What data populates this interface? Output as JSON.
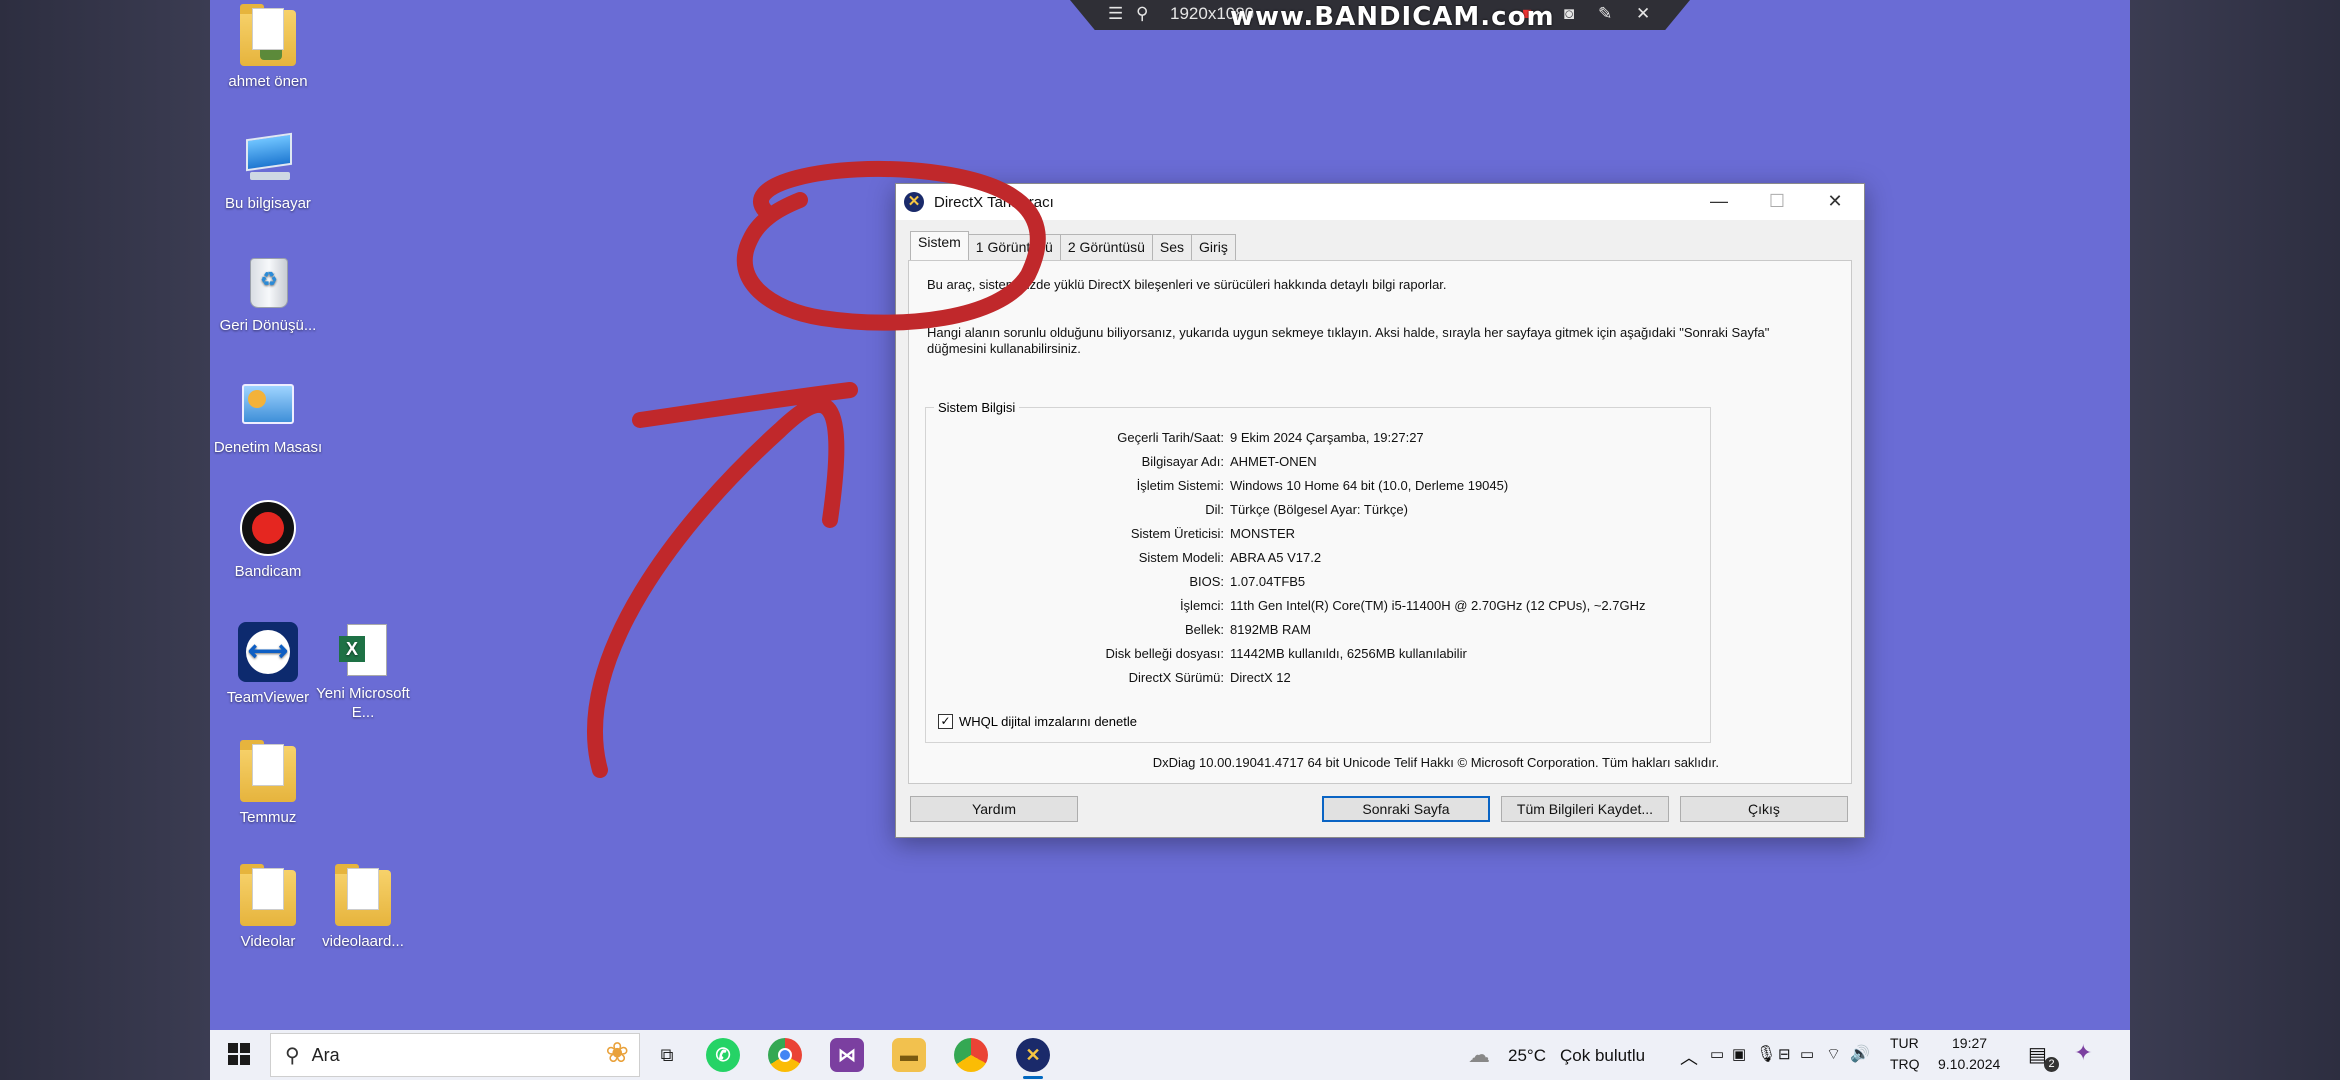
{
  "bandicam": {
    "resolution": "1920x1080",
    "watermark": "www.BANDICAM.com"
  },
  "desktop_icons": [
    {
      "label": "ahmet önen",
      "icon": "user-folder-icon"
    },
    {
      "label": "Bu bilgisayar",
      "icon": "computer-icon"
    },
    {
      "label": "Geri Dönüşü...",
      "icon": "recycle-bin-icon"
    },
    {
      "label": "Denetim Masası",
      "icon": "control-panel-icon"
    },
    {
      "label": "Bandicam",
      "icon": "bandicam-icon"
    },
    {
      "label": "TeamViewer",
      "icon": "teamviewer-icon"
    },
    {
      "label": "Yeni Microsoft E...",
      "icon": "excel-file-icon"
    },
    {
      "label": "Temmuz",
      "icon": "folder-icon"
    },
    {
      "label": "Videolar",
      "icon": "folder-icon"
    },
    {
      "label": "videolaard...",
      "icon": "folder-icon"
    }
  ],
  "window": {
    "title": "DirectX Tanı Aracı",
    "tabs": [
      "Sistem",
      "1 Görüntüsü",
      "2 Görüntüsü",
      "Ses",
      "Giriş"
    ],
    "intro1": "Bu araç, sisteminizde yüklü DirectX bileşenleri ve sürücüleri hakkında detaylı bilgi raporlar.",
    "intro2": "Hangi alanın sorunlu olduğunu biliyorsanız, yukarıda uygun sekmeye tıklayın. Aksi halde, sırayla her sayfaya gitmek için aşağıdaki \"Sonraki Sayfa\" düğmesini kullanabilirsiniz.",
    "system_info_title": "Sistem Bilgisi",
    "info": [
      {
        "key": "Geçerli Tarih/Saat:",
        "value": "9 Ekim 2024 Çarşamba, 19:27:27"
      },
      {
        "key": "Bilgisayar Adı:",
        "value": "AHMET-ONEN"
      },
      {
        "key": "İşletim Sistemi:",
        "value": "Windows 10 Home 64 bit (10.0, Derleme 19045)"
      },
      {
        "key": "Dil:",
        "value": "Türkçe (Bölgesel Ayar: Türkçe)"
      },
      {
        "key": "Sistem Üreticisi:",
        "value": "MONSTER"
      },
      {
        "key": "Sistem Modeli:",
        "value": "ABRA A5 V17.2"
      },
      {
        "key": "BIOS:",
        "value": "1.07.04TFB5"
      },
      {
        "key": "İşlemci:",
        "value": "11th Gen Intel(R) Core(TM) i5-11400H @ 2.70GHz (12 CPUs), ~2.7GHz"
      },
      {
        "key": "Bellek:",
        "value": "8192MB RAM"
      },
      {
        "key": "Disk belleği dosyası:",
        "value": "11442MB kullanıldı, 6256MB kullanılabilir"
      },
      {
        "key": "DirectX Sürümü:",
        "value": "DirectX 12"
      }
    ],
    "whql_label": "WHQL dijital imzalarını denetle",
    "whql_checked": true,
    "footer": "DxDiag 10.00.19041.4717 64 bit Unicode  Telif Hakkı © Microsoft Corporation. Tüm hakları saklıdır.",
    "buttons": {
      "help": "Yardım",
      "next": "Sonraki Sayfa",
      "save": "Tüm Bilgileri Kaydet...",
      "exit": "Çıkış"
    }
  },
  "taskbar": {
    "search_placeholder": "Ara",
    "weather_temp": "25°C",
    "weather_text": "Çok bulutlu",
    "lang_top": "TUR",
    "lang_bottom": "TRQ",
    "time": "19:27",
    "date": "9.10.2024",
    "notification_count": "2"
  },
  "colors": {
    "desktop": "#6a6cd5",
    "annotation": "#c0282b",
    "accent": "#0a64c4"
  }
}
